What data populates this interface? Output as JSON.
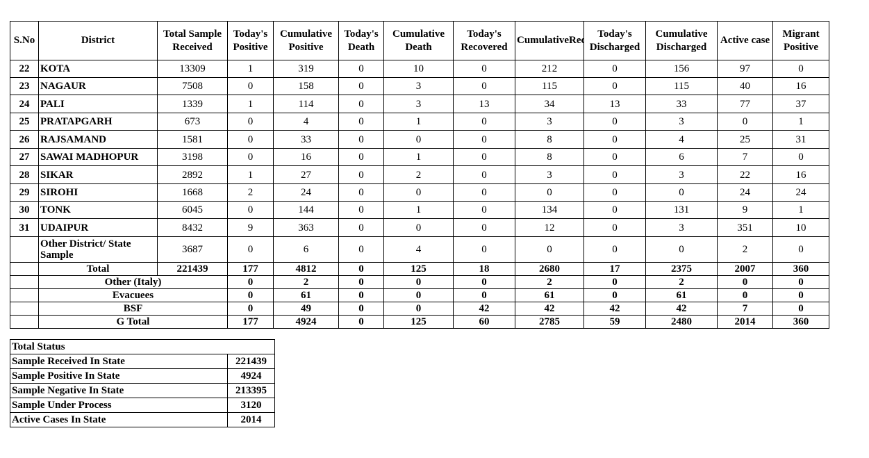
{
  "main_table": {
    "headers": [
      "S.No",
      "District",
      "Total Sample Received",
      "Today's Positive",
      "Cumulative Positive",
      "Today's Death",
      "Cumulative Death",
      "Today's Recovered",
      "CumulativeRecovered",
      "Today's Discharged",
      "Cumulative Discharged",
      "Active  case",
      "Migrant Positive"
    ],
    "rows": [
      [
        "22",
        "KOTA",
        "13309",
        "1",
        "319",
        "0",
        "10",
        "0",
        "212",
        "0",
        "156",
        "97",
        "0"
      ],
      [
        "23",
        "NAGAUR",
        "7508",
        "0",
        "158",
        "0",
        "3",
        "0",
        "115",
        "0",
        "115",
        "40",
        "16"
      ],
      [
        "24",
        "PALI",
        "1339",
        "1",
        "114",
        "0",
        "3",
        "13",
        "34",
        "13",
        "33",
        "77",
        "37"
      ],
      [
        "25",
        "PRATAPGARH",
        "673",
        "0",
        "4",
        "0",
        "1",
        "0",
        "3",
        "0",
        "3",
        "0",
        "1"
      ],
      [
        "26",
        "RAJSAMAND",
        "1581",
        "0",
        "33",
        "0",
        "0",
        "0",
        "8",
        "0",
        "4",
        "25",
        "31"
      ],
      [
        "27",
        "SAWAI MADHOPUR",
        "3198",
        "0",
        "16",
        "0",
        "1",
        "0",
        "8",
        "0",
        "6",
        "7",
        "0"
      ],
      [
        "28",
        "SIKAR",
        "2892",
        "1",
        "27",
        "0",
        "2",
        "0",
        "3",
        "0",
        "3",
        "22",
        "16"
      ],
      [
        "29",
        "SIROHI",
        "1668",
        "2",
        "24",
        "0",
        "0",
        "0",
        "0",
        "0",
        "0",
        "24",
        "24"
      ],
      [
        "30",
        "TONK",
        "6045",
        "0",
        "144",
        "0",
        "1",
        "0",
        "134",
        "0",
        "131",
        "9",
        "1"
      ],
      [
        "31",
        "UDAIPUR",
        "8432",
        "9",
        "363",
        "0",
        "0",
        "0",
        "12",
        "0",
        "3",
        "351",
        "10"
      ],
      [
        "",
        "Other District/ State Sample",
        "3687",
        "0",
        "6",
        "0",
        "4",
        "0",
        "0",
        "0",
        "0",
        "2",
        "0"
      ]
    ],
    "total": [
      "Total",
      "221439",
      "177",
      "4812",
      "0",
      "125",
      "18",
      "2680",
      "17",
      "2375",
      "2007",
      "360"
    ],
    "extra": [
      [
        "Other (Italy)",
        "0",
        "2",
        "0",
        "0",
        "0",
        "2",
        "0",
        "2",
        "0",
        "0"
      ],
      [
        "Evacuees",
        "0",
        "61",
        "0",
        "0",
        "0",
        "61",
        "0",
        "61",
        "0",
        "0"
      ],
      [
        "BSF",
        "0",
        "49",
        "0",
        "0",
        "42",
        "42",
        "42",
        "42",
        "7",
        "0"
      ],
      [
        "G Total",
        "177",
        "4924",
        "0",
        "125",
        "60",
        "2785",
        "59",
        "2480",
        "2014",
        "360"
      ]
    ]
  },
  "summary": {
    "title": "Total Status",
    "rows": [
      [
        "Sample Received In State",
        "221439"
      ],
      [
        "Sample Positive In State",
        "4924"
      ],
      [
        "Sample Negative In State",
        "213395"
      ],
      [
        "Sample Under Process",
        "3120"
      ],
      [
        "Active Cases In State",
        "2014"
      ]
    ]
  }
}
